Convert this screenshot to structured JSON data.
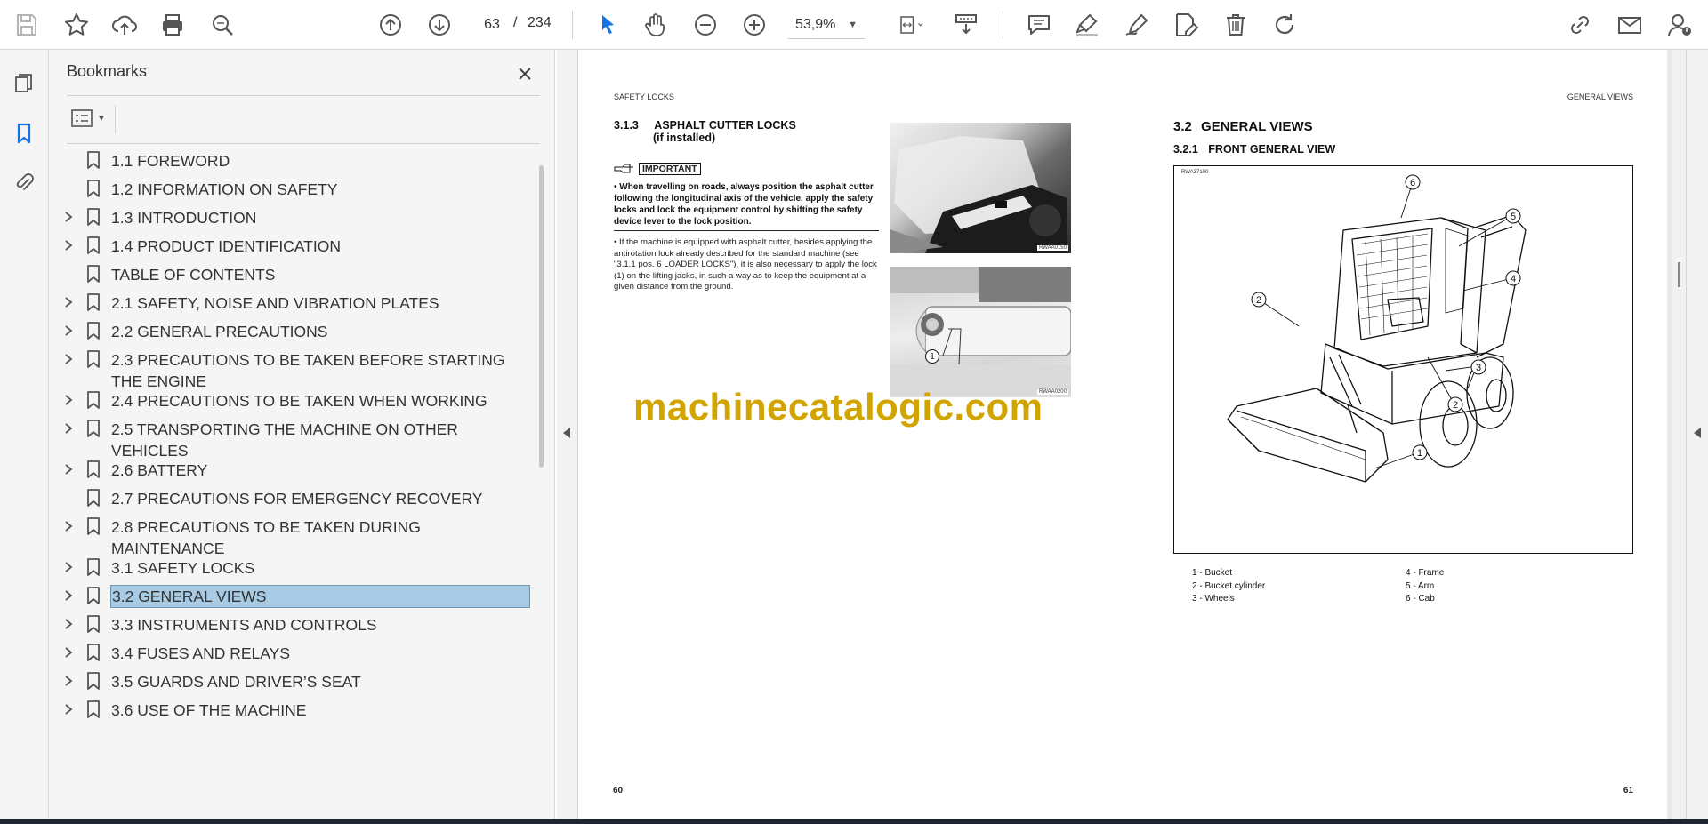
{
  "toolbar": {
    "current_page": "63",
    "page_separator": "/",
    "total_pages": "234",
    "zoom": "53,9%"
  },
  "bookmarks": {
    "title": "Bookmarks",
    "items": [
      {
        "label": "1.1 FOREWORD",
        "expandable": false
      },
      {
        "label": "1.2 INFORMATION ON SAFETY",
        "expandable": false
      },
      {
        "label": "1.3 INTRODUCTION",
        "expandable": true
      },
      {
        "label": "1.4 PRODUCT IDENTIFICATION",
        "expandable": true
      },
      {
        "label": "TABLE OF CONTENTS",
        "expandable": false
      },
      {
        "label": "2.1 SAFETY, NOISE AND VIBRATION PLATES",
        "expandable": true
      },
      {
        "label": "2.2 GENERAL PRECAUTIONS",
        "expandable": true
      },
      {
        "label": "2.3 PRECAUTIONS TO BE TAKEN BEFORE STARTING THE ENGINE",
        "expandable": true
      },
      {
        "label": "2.4 PRECAUTIONS TO BE TAKEN WHEN WORKING",
        "expandable": true
      },
      {
        "label": "2.5 TRANSPORTING THE MACHINE ON OTHER VEHICLES",
        "expandable": true
      },
      {
        "label": "2.6 BATTERY",
        "expandable": true
      },
      {
        "label": "2.7 PRECAUTIONS FOR EMERGENCY RECOVERY",
        "expandable": false
      },
      {
        "label": "2.8 PRECAUTIONS TO BE TAKEN DURING MAINTENANCE",
        "expandable": true
      },
      {
        "label": "3.1 SAFETY LOCKS",
        "expandable": true
      },
      {
        "label": "3.2 GENERAL VIEWS",
        "expandable": true,
        "selected": true
      },
      {
        "label": "3.3 INSTRUMENTS AND CONTROLS",
        "expandable": true
      },
      {
        "label": "3.4 FUSES AND RELAYS",
        "expandable": true
      },
      {
        "label": "3.5 GUARDS AND DRIVER’S SEAT",
        "expandable": true
      },
      {
        "label": "3.6 USE OF THE MACHINE",
        "expandable": true
      }
    ]
  },
  "left_page": {
    "header": "SAFETY LOCKS",
    "section_number": "3.1.3",
    "section_title": "ASPHALT CUTTER LOCKS",
    "section_subtitle": "(if installed)",
    "important_label": "IMPORTANT",
    "important_text": "When travelling on roads, always position the asphalt cutter following the longitudinal axis of the vehicle, apply the safety locks and lock the equipment control by shifting the safety device lever to the lock position.",
    "body_text": "If the machine is equipped with asphalt cutter, besides applying the antirotation lock already described for the standard machine (see \"3.1.1 pos. 6 LOADER LOCKS\"), it is also necessary to apply the lock (1) on the lifting jacks, in such a way as to keep the equipment at a given distance from the ground.",
    "photo1_tag": "RWAA0150",
    "photo2_tag": "RWAA0200",
    "photo2_callout": "1",
    "page_number": "60"
  },
  "right_page": {
    "header": "GENERAL VIEWS",
    "section_number": "3.2",
    "section_title": "GENERAL VIEWS",
    "subsection_number": "3.2.1",
    "subsection_title": "FRONT GENERAL VIEW",
    "figure_tag": "RWA37100",
    "callouts": [
      "1",
      "2",
      "2",
      "3",
      "4",
      "5",
      "6"
    ],
    "legend_left": [
      "1 - Bucket",
      "2 - Bucket cylinder",
      "3 - Wheels"
    ],
    "legend_right": [
      "4 - Frame",
      "5 - Arm",
      "6 - Cab"
    ],
    "page_number": "61"
  },
  "watermark": "machinecatalogic.com",
  "colors": {
    "accent_blue": "#1473e6",
    "selection": "#a7cbe4",
    "watermark": "#d2a400"
  }
}
